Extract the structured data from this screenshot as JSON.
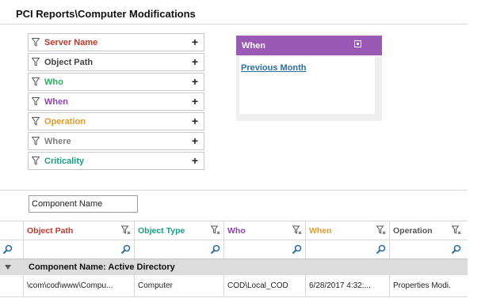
{
  "page": {
    "title": "PCI Reports\\Computer Modifications"
  },
  "filters": [
    {
      "label": "Server Name",
      "color": "#c0392b"
    },
    {
      "label": "Object Path",
      "color": "#444444"
    },
    {
      "label": "Who",
      "color": "#27ae60"
    },
    {
      "label": "When",
      "color": "#8e44ad"
    },
    {
      "label": "Operation",
      "color": "#e69a27"
    },
    {
      "label": "Where",
      "color": "#7f7f7f"
    },
    {
      "label": "Criticality",
      "color": "#16a085"
    }
  ],
  "when_panel": {
    "title": "When",
    "header_color": "#9b59b6",
    "link": "Previous Month"
  },
  "grouping": {
    "chip_label": "Component Name"
  },
  "grid": {
    "columns": [
      {
        "label": "Object Path",
        "color": "#c0392b"
      },
      {
        "label": "Object Type",
        "color": "#16a085"
      },
      {
        "label": "Who",
        "color": "#8e44ad"
      },
      {
        "label": "When",
        "color": "#e69a27"
      },
      {
        "label": "Operation",
        "color": "#555555"
      }
    ],
    "group_label": "Component Name: Active Directory",
    "rows": [
      [
        "\\com\\cod\\www\\Compu...",
        "Computer",
        "COD\\Local_COD",
        "6/28/2017 4:32:...",
        "Properties Modi."
      ]
    ]
  },
  "icons": {
    "filter": "funnel-icon",
    "add": "plus-icon",
    "search": "search-icon",
    "collapse": "collapse-triangle-icon"
  }
}
